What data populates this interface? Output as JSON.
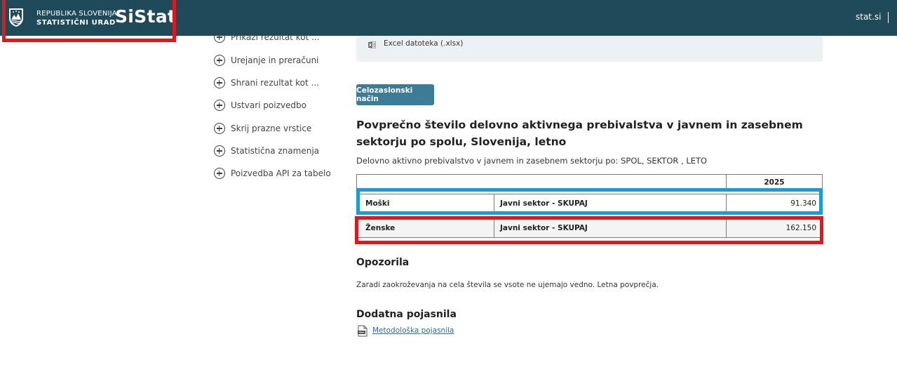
{
  "header": {
    "org_line1": "REPUBLIKA SLOVENIJA",
    "org_line2": "STATISTIČNI URAD",
    "brand": "SiStat",
    "site_link": "stat.si",
    "colors": {
      "bar": "#1f4a5a",
      "highlight_red": "#e3161b"
    }
  },
  "sidebar": {
    "items": [
      {
        "label": "Prikaži rezultat kot ...",
        "icon": "plus-circle-icon"
      },
      {
        "label": "Urejanje in preračuni",
        "icon": "plus-circle-icon"
      },
      {
        "label": "Shrani rezultat kot ...",
        "icon": "plus-circle-icon"
      },
      {
        "label": "Ustvari poizvedbo",
        "icon": "plus-circle-icon"
      },
      {
        "label": "Skrij prazne vrstice",
        "icon": "plus-circle-icon"
      },
      {
        "label": "Statistična znamenja",
        "icon": "plus-circle-icon"
      },
      {
        "label": "Poizvedba API za tabelo",
        "icon": "plus-circle-icon"
      }
    ]
  },
  "export": {
    "excel_label": "Excel datoteka (.xlsx)",
    "icon": "excel-file-icon"
  },
  "fullscreen_button": "Celozaslonski način",
  "table_title": "Povprečno število delovno aktivnega prebivalstva v javnem in zasebnem sektorju po spolu, Slovenija, letno",
  "table_subtitle": "Delovno aktivno prebivalstvo v javnem in zasebnem sektorju po: SPOL, SEKTOR , LETO",
  "table": {
    "year_header": "2025",
    "rows": [
      {
        "sex": "Moški",
        "sector": "Javni sektor - SKUPAJ",
        "value": "91.340"
      },
      {
        "sex": "Ženske",
        "sector": "Javni sektor - SKUPAJ",
        "value": "162.150"
      }
    ],
    "highlight_colors": {
      "row1": "#1b9bd7",
      "row2": "#e3161b"
    }
  },
  "notes": {
    "heading": "Opozorila",
    "text": "Zaradi zaokroževanja na cela števila se vsote ne ujemajo vedno. Letna povprečja."
  },
  "extra": {
    "heading": "Dodatna pojasnila",
    "link": "Metodološka pojasnila",
    "icon": "document-icon"
  }
}
